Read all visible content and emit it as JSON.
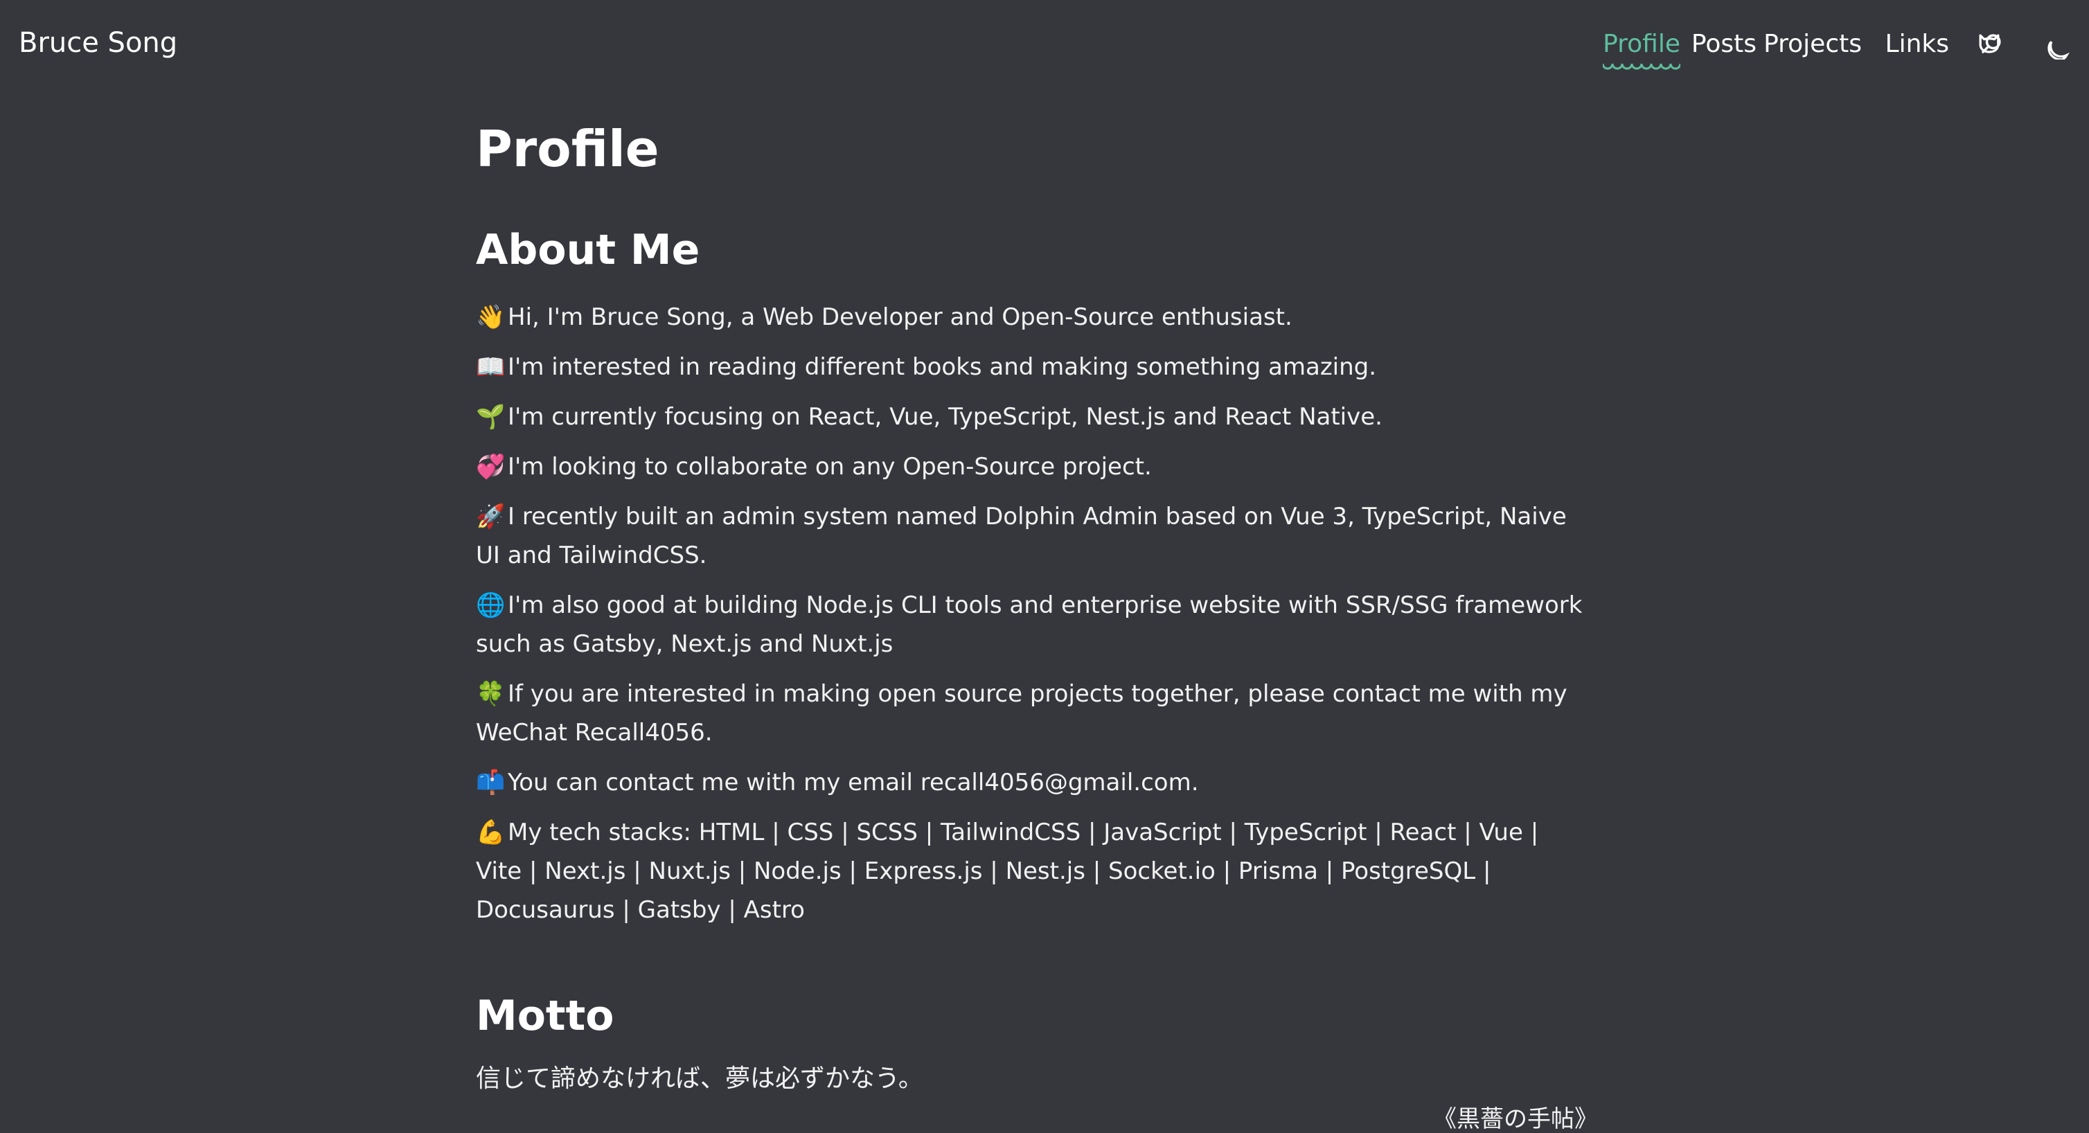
{
  "site": {
    "brand": "Bruce Song"
  },
  "nav": {
    "items": [
      {
        "label": "Profile",
        "active": true
      },
      {
        "label": "Posts",
        "active": false
      },
      {
        "label": "Projects",
        "active": false
      },
      {
        "label": "Links",
        "active": false
      }
    ],
    "icons": [
      "github-icon",
      "search-icon",
      "moon-icon"
    ]
  },
  "colors": {
    "background": "#36373d",
    "accent": "#5fbf9e",
    "text": "#ffffff"
  },
  "page": {
    "title": "Profile"
  },
  "about": {
    "heading": "About Me",
    "items": [
      {
        "emoji": "👋",
        "text": "Hi, I'm Bruce Song, a Web Developer and Open-Source enthusiast."
      },
      {
        "emoji": "📖",
        "text": "I'm interested in reading different books and making something amazing."
      },
      {
        "emoji": "🌱",
        "text": "I'm currently focusing on React, Vue, TypeScript, Nest.js and React Native."
      },
      {
        "emoji": "💞",
        "text": "I'm looking to collaborate on any Open-Source project."
      },
      {
        "emoji": "🚀",
        "text": "I recently built an admin system named Dolphin Admin based on Vue 3, TypeScript, Naive UI and TailwindCSS."
      },
      {
        "emoji": "🌐",
        "text": "I'm also good at building Node.js CLI tools and enterprise website with SSR/SSG framework such as Gatsby, Next.js and Nuxt.js"
      },
      {
        "emoji": "🍀",
        "text": "If you are interested in making open source projects together, please contact me with my WeChat Recall4056."
      },
      {
        "emoji": "📫",
        "text": "You can contact me with my email recall4056@gmail.com."
      },
      {
        "emoji": "💪",
        "text": "My tech stacks: HTML | CSS | SCSS | TailwindCSS | JavaScript | TypeScript | React | Vue | Vite | Next.js | Nuxt.js | Node.js | Express.js | Nest.js | Socket.io | Prisma | PostgreSQL | Docusaurus | Gatsby | Astro"
      }
    ]
  },
  "motto": {
    "heading": "Motto",
    "text": "信じて諦めなければ、夢は必ずかなう。",
    "source": "《黒薔の手帖》"
  }
}
